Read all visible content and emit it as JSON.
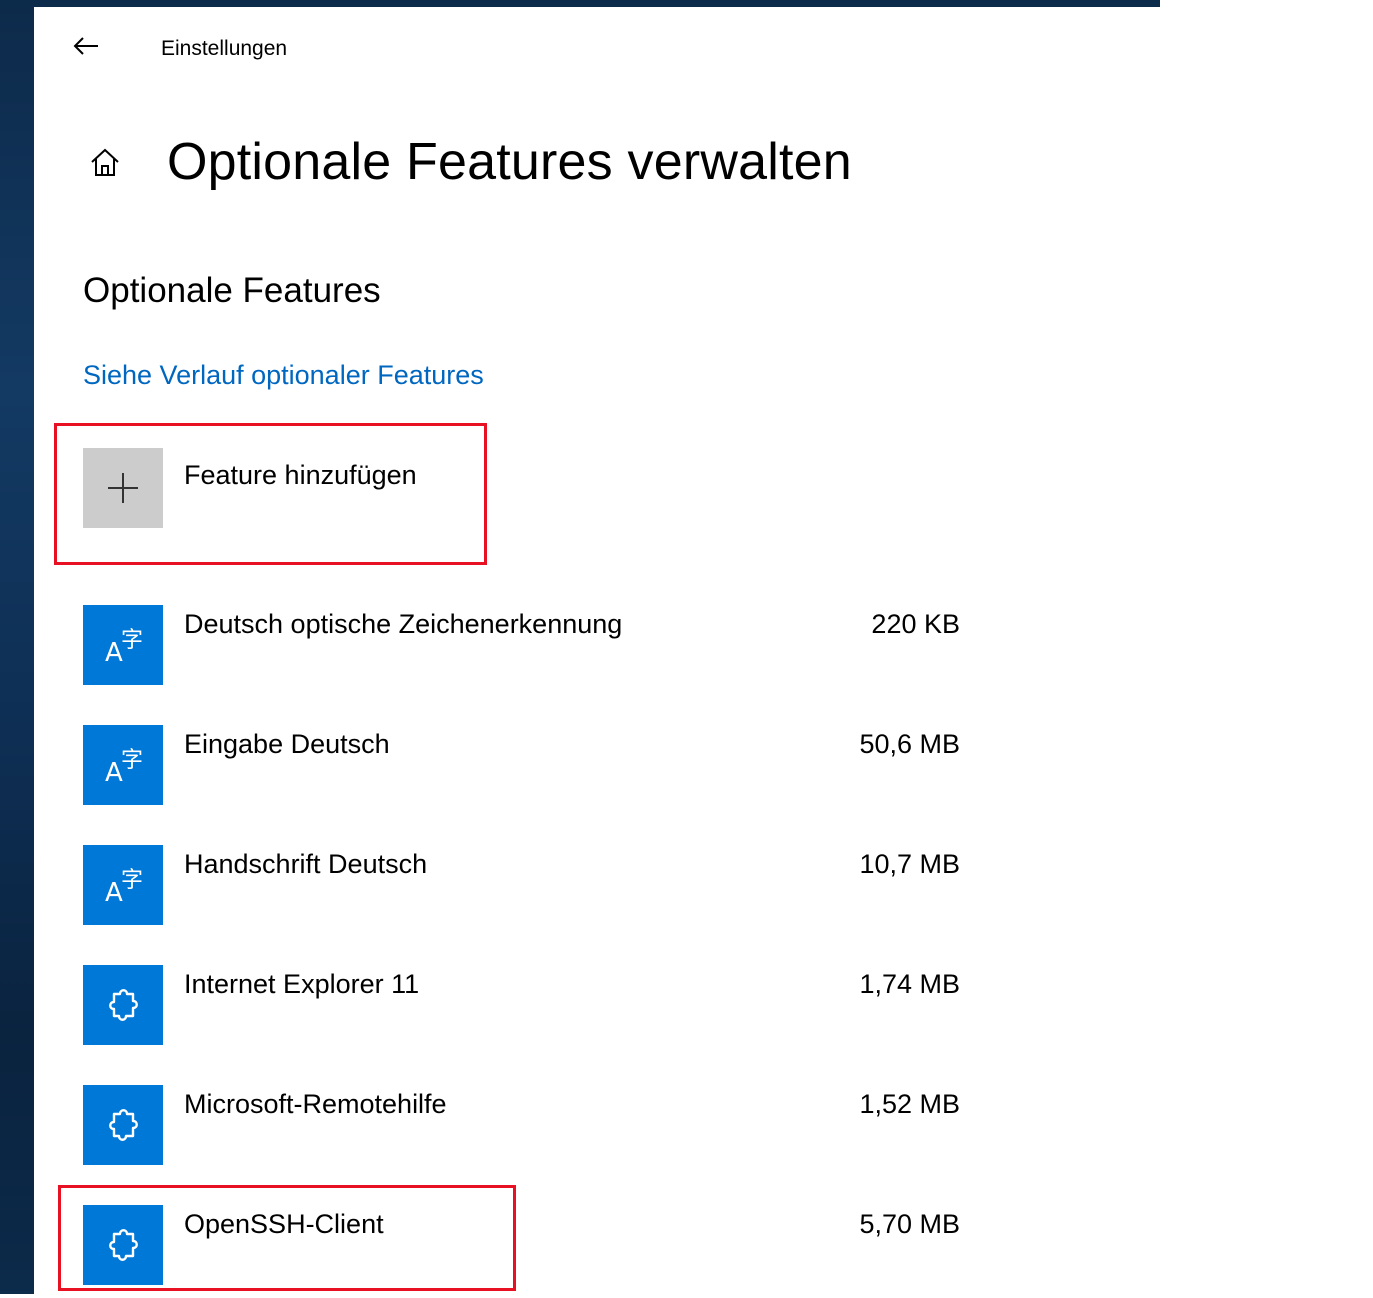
{
  "window": {
    "app_title": "Einstellungen"
  },
  "header": {
    "page_title": "Optionale Features verwalten"
  },
  "section": {
    "title": "Optionale Features",
    "history_link": "Siehe Verlauf optionaler Features"
  },
  "add_feature": {
    "label": "Feature hinzufügen",
    "icon": "plus-icon"
  },
  "features": [
    {
      "name": "Deutsch optische Zeichenerkennung",
      "size": "220 KB",
      "icon": "language-icon"
    },
    {
      "name": "Eingabe Deutsch",
      "size": "50,6 MB",
      "icon": "language-icon"
    },
    {
      "name": "Handschrift Deutsch",
      "size": "10,7 MB",
      "icon": "language-icon"
    },
    {
      "name": "Internet Explorer 11",
      "size": "1,74 MB",
      "icon": "puzzle-icon"
    },
    {
      "name": "Microsoft-Remotehilfe",
      "size": "1,52 MB",
      "icon": "puzzle-icon"
    },
    {
      "name": "OpenSSH-Client",
      "size": "5,70 MB",
      "icon": "puzzle-icon"
    }
  ],
  "colors": {
    "accent": "#0078d7",
    "link": "#0067c0",
    "highlight_border": "#e81123",
    "add_tile": "#cccccc"
  }
}
